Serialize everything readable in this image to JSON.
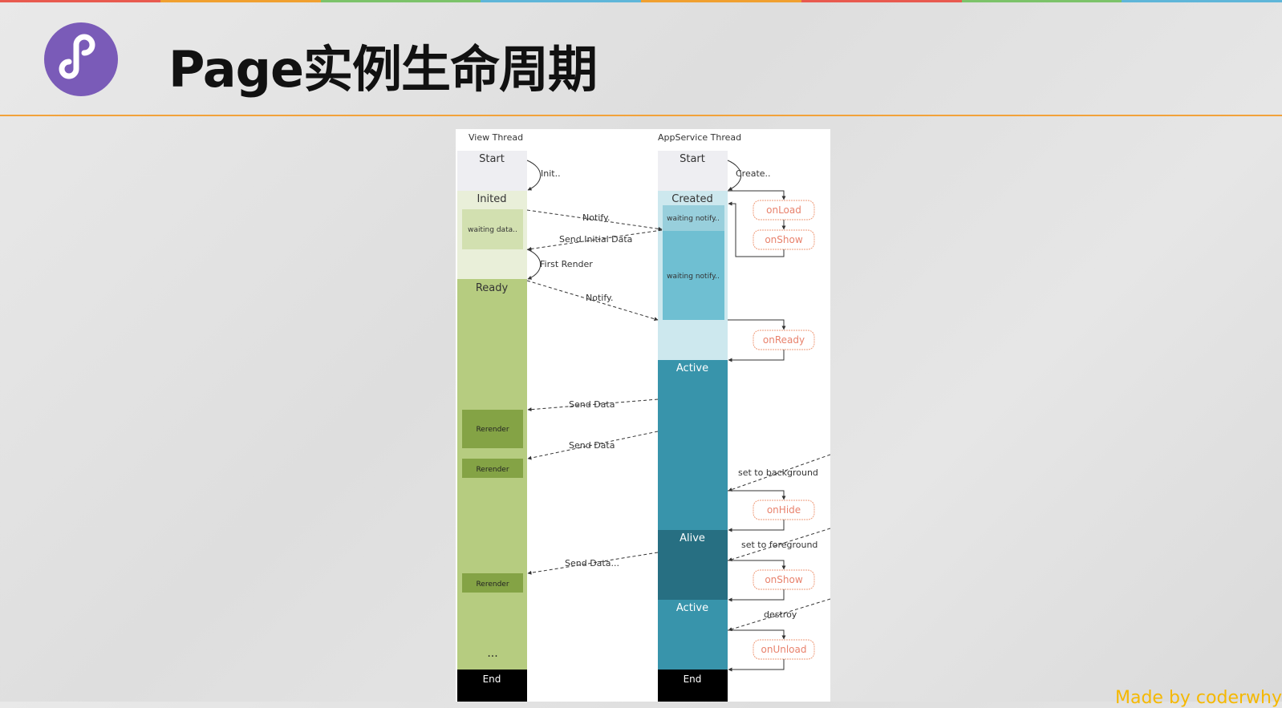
{
  "title": "Page实例生命周期",
  "footer": "Made by coderwhy",
  "colors": {
    "accent_line": "#f2a23a",
    "logo_bg": "#7a5bb8",
    "footer_text": "#f5b800",
    "hook_text": "#e8826d"
  },
  "diagram": {
    "view_thread": {
      "label": "View Thread",
      "states": {
        "start": "Start",
        "inited": "Inited",
        "waiting": "waiting data..",
        "ready": "Ready",
        "rerender": "Rerender",
        "dots": "...",
        "end": "End"
      }
    },
    "app_thread": {
      "label": "AppService Thread",
      "states": {
        "start": "Start",
        "created": "Created",
        "waiting1": "waiting notify..",
        "waiting2": "waiting notify..",
        "active": "Active",
        "alive": "Alive",
        "active2": "Active",
        "end": "End"
      }
    },
    "hooks": {
      "onload": "onLoad",
      "onshow1": "onShow",
      "onready": "onReady",
      "onhide": "onHide",
      "onshow2": "onShow",
      "onunload": "onUnload"
    },
    "messages": {
      "init": "Init..",
      "create": "Create..",
      "notify1": "Notify.",
      "send_initial": "Send Initial Data",
      "first_render": "First Render",
      "notify2": "Notify.",
      "send_data1": "Send Data",
      "send_data2": "Send Data",
      "send_data3": "Send Data...",
      "set_background": "set to background",
      "set_foreground": "set to foreground",
      "destroy": "destroy"
    }
  }
}
